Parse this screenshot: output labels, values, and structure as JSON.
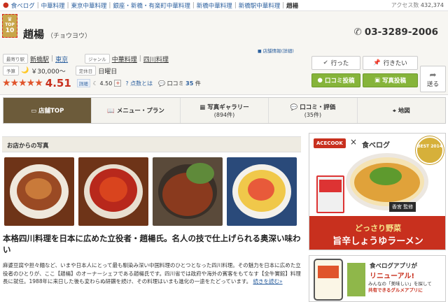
{
  "breadcrumb": {
    "items": [
      "食べログ",
      "中華料理",
      "東京中華料理",
      "銀座・新橋・有楽町中華料理",
      "新橋中華料理",
      "新橋駅中華料理"
    ],
    "current": "趙楊"
  },
  "access": {
    "label": "アクセス数",
    "value": "432,374"
  },
  "badge": {
    "line1": "TOP",
    "line2": "10"
  },
  "restaurant": {
    "name": "趙楊",
    "kana": "（チョウヨウ）"
  },
  "phone": "03-3289-2006",
  "info_link": "店舗情報(詳細)",
  "details": {
    "station_label": "最寄り駅",
    "station1": "新橋駅",
    "station2": "東京",
    "genre_label": "ジャンル",
    "genre1": "中華料理",
    "genre2": "四川料理",
    "budget_label": "予算",
    "budget_icon": "🌙",
    "budget_value": "￥30,000～",
    "holiday_label": "定休日",
    "holiday_value": "日曜日"
  },
  "rating": {
    "stars": "★★★★★",
    "score": "4.51",
    "detail_label": "詳細",
    "dinner_score": "4.50",
    "points_label": "点数とは",
    "reviews_label": "口コミ",
    "reviews_count": "35",
    "reviews_unit": "件"
  },
  "actions": {
    "went": "行った",
    "want": "行きたい",
    "review_post": "口コミ投稿",
    "photo_post": "写真投稿",
    "share": "送る"
  },
  "tabs": [
    {
      "label": "店舗TOP",
      "sub": ""
    },
    {
      "label": "メニュー・プラン",
      "sub": ""
    },
    {
      "label": "写真ギャラリー",
      "sub": "(894件)"
    },
    {
      "label": "口コミ・評価",
      "sub": "(35件)"
    },
    {
      "label": "地図",
      "sub": ""
    }
  ],
  "photos_header": "お店からの写真",
  "headline": "本格四川料理を日本に広めた立役者・趙楊氏。名人の技で仕上げられる奥深い味わい",
  "description": "麻婆豆腐や担々麺など、いまや日本人にとって最も馴染み深い中国料理のひとつとなった四川料理。その魅力を日本に広めた立役者のひとりが、ここ【趙楊】のオーナーシェフである趙楊氏です。四川省では政府や海外の賓客をもてなす【全牛實館】料理長に就任。1988年に来日した後も変わらぬ研鑽を続け、その料理はいまも進化の一途をたどっています。",
  "more_link": "続きを読む»",
  "ad1": {
    "brand": "ACECOOK",
    "x": "×",
    "partner": "食べログ",
    "best": "BEST 2014",
    "kaku": "香宮 監修",
    "copy1": "どっさり野菜",
    "copy2": "旨辛しょうゆラーメン"
  },
  "ad2": {
    "line1": "食べログアプリが",
    "line2": "リニューアル!",
    "line3a": "みんなの「美味しい」を探して",
    "line3b": "共有できるグルメアプリに"
  },
  "colors": {
    "brand_red": "#c8301e",
    "tab_active": "#6c5b3a",
    "green_button": "#86b43a"
  }
}
